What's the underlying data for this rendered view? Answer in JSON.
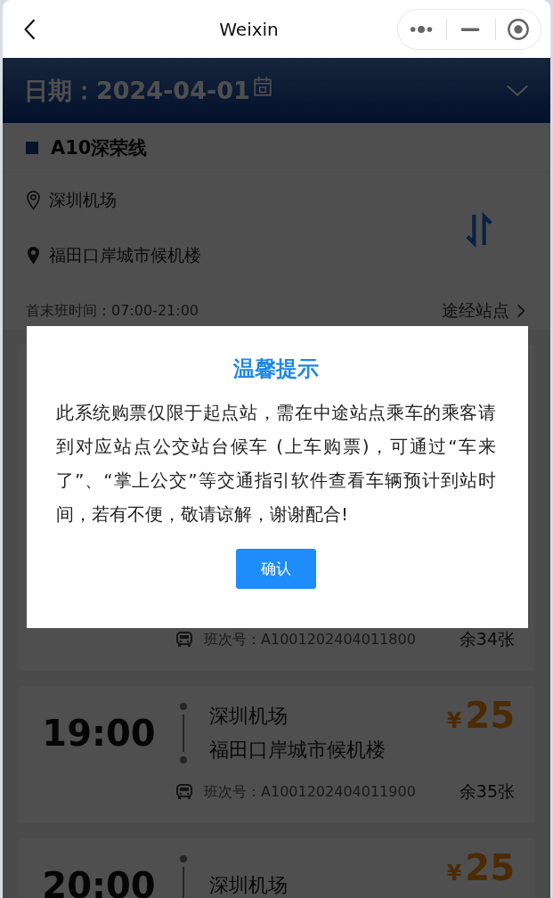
{
  "window": {
    "title": "Weixin"
  },
  "header": {
    "date": "日期：2024-04-01"
  },
  "route": {
    "line_name": "A10深荣线",
    "from": "深圳机场",
    "to": "福田口岸城市候机楼",
    "hours": "首末班时间：07:00-21:00",
    "stops_link": "途经站点"
  },
  "trips": [
    {
      "trip_no": "班次号：A1001202404011800",
      "remaining": "余34张"
    },
    {
      "time": "19:00",
      "from": "深圳机场",
      "to": "福田口岸城市候机楼",
      "currency": "¥",
      "price": "25",
      "trip_no": "班次号：A1001202404011900",
      "remaining": "余35张"
    },
    {
      "time": "20:00",
      "from": "深圳机场",
      "currency": "¥",
      "price": "25"
    }
  ],
  "dialog": {
    "title": "温馨提示",
    "message": "此系统购票仅限于起点站，需在中途站点乘车的乘客请到对应站点公交站台候车 (上车购票)，可通过“车来了”、“掌上公交”等交通指引软件查看车辆预计到站时间，若有不便，敬请谅解，谢谢配合!",
    "button": "确认"
  }
}
